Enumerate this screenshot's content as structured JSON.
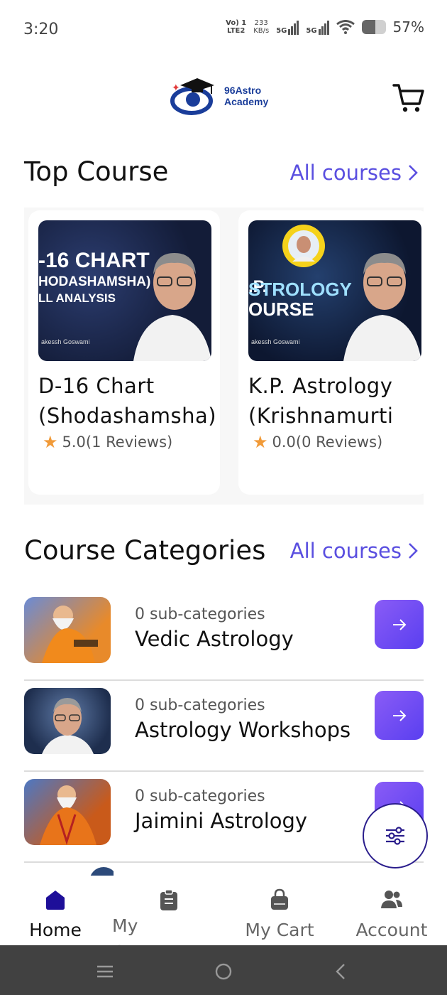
{
  "status_bar": {
    "time": "3:20",
    "lte_label_top": "Vo) 1",
    "lte_label_bottom": "LTE2",
    "speed_top": "233",
    "speed_bottom": "KB/s",
    "net1": "5G",
    "net2": "5G",
    "battery_level": 0.57,
    "battery_text": "57%"
  },
  "header": {
    "logo_text_line1": "96Astro",
    "logo_text_line2": "Academy",
    "cart_icon": "cart-icon"
  },
  "top_course": {
    "title": "Top Course",
    "all_link": "All courses",
    "courses": [
      {
        "thumb_line1": "-16 CHART",
        "thumb_line2": "HODASHAMSHA)",
        "thumb_line3": "LL ANALYSIS",
        "thumb_author": "akessh Goswami",
        "name": "D-16 Chart (Shodashamsha)",
        "rating_text": "5.0(1 Reviews)"
      },
      {
        "thumb_line1": ".P.",
        "thumb_line2": "STROLOGY",
        "thumb_line3": "OURSE",
        "thumb_author": "akessh Goswami",
        "name": "K.P. Astrology (Krishnamurti",
        "rating_text": "0.0(0 Reviews)"
      }
    ]
  },
  "categories": {
    "title": "Course Categories",
    "all_link": "All courses",
    "items": [
      {
        "sub": "0 sub-categories",
        "name": "Vedic Astrology"
      },
      {
        "sub": "0 sub-categories",
        "name": "Astrology Workshops"
      },
      {
        "sub": "0 sub-categories",
        "name": "Jaimini Astrology"
      }
    ]
  },
  "fab_icon": "filter-sliders-icon",
  "bottom_nav": [
    {
      "label": "Home",
      "icon": "home-icon",
      "active": true
    },
    {
      "label": "My Courses",
      "icon": "clipboard-icon",
      "active": false
    },
    {
      "label": "My Cart",
      "icon": "shopping-bag-icon",
      "active": false
    },
    {
      "label": "Account",
      "icon": "users-icon",
      "active": false
    }
  ],
  "colors": {
    "accent": "#5a4fe0",
    "arrow_gradient_start": "#8a5cf6",
    "arrow_gradient_end": "#5a3ff0",
    "nav_active": "#1e0f99",
    "star": "#f19a38"
  }
}
